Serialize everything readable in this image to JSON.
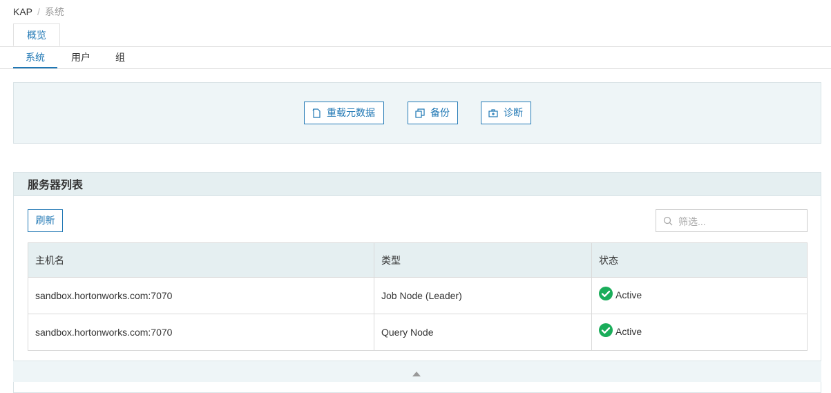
{
  "breadcrumb": {
    "root": "KAP",
    "separator": "/",
    "current": "系统"
  },
  "top_tabs": [
    {
      "label": "概览"
    }
  ],
  "sub_tabs": [
    {
      "label": "系统"
    },
    {
      "label": "用户"
    },
    {
      "label": "组"
    }
  ],
  "actions": {
    "reload": "重载元数据",
    "backup": "备份",
    "diagnose": "诊断"
  },
  "server_list": {
    "title": "服务器列表",
    "refresh": "刷新",
    "filter_placeholder": "筛选...",
    "columns": [
      "主机名",
      "类型",
      "状态"
    ],
    "rows": [
      {
        "host": "sandbox.hortonworks.com:7070",
        "type": "Job Node (Leader)",
        "status": "Active"
      },
      {
        "host": "sandbox.hortonworks.com:7070",
        "type": "Query Node",
        "status": "Active"
      }
    ]
  },
  "colors": {
    "accent": "#1f77b4",
    "status_ok": "#1aad5a",
    "panel_bg": "#eef5f7"
  }
}
